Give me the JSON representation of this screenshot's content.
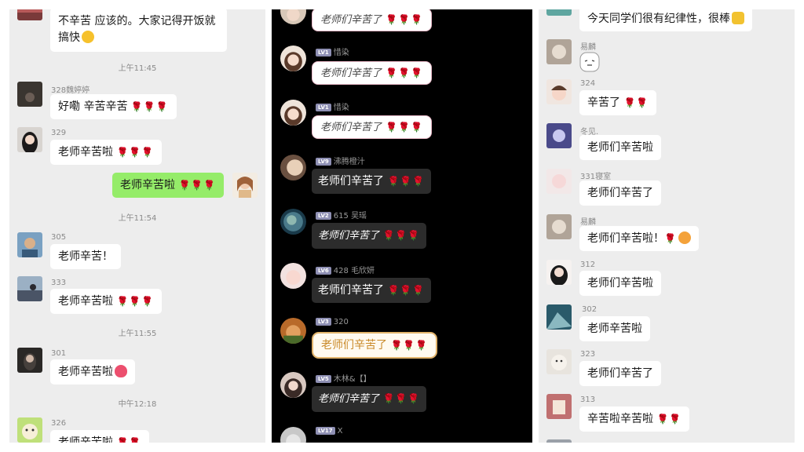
{
  "left": {
    "top_message": "不辛苦 应该的。大家记得开饭就搞快",
    "time1": "上午11:45",
    "m1_name": "328魏婷婷",
    "m1_text": "好嘞 辛苦辛苦",
    "m2_name": "329",
    "m2_text": "老师辛苦啦",
    "self_text": "老师辛苦啦",
    "time2": "上午11:54",
    "m3_name": "305",
    "m3_text": "老师辛苦！",
    "m4_name": "333",
    "m4_text": "老师辛苦啦",
    "time3": "上午11:55",
    "m5_name": "301",
    "m5_text": "老师辛苦啦",
    "time4": "中午12:18",
    "m6_name": "326",
    "m6_text": "老师辛苦啦"
  },
  "middle": {
    "msg1_text": "老师们辛苦了",
    "msg2_badge": "LV1",
    "msg2_name": "惜染",
    "msg2_text": "老师们辛苦了",
    "msg3_badge": "LV1",
    "msg3_name": "惜染",
    "msg3_text": "老师们辛苦了",
    "msg4_badge": "LV9",
    "msg4_name": "沸腾橙汁",
    "msg4_text": "老师们辛苦了",
    "msg5_badge": "LV2",
    "msg5_name": "615 吴瑶",
    "msg5_text": "老师们辛苦了",
    "msg6_badge": "LV6",
    "msg6_name": "428 毛欣妍",
    "msg6_text": "老师们辛苦了",
    "msg7_badge": "LV3",
    "msg7_name": "320",
    "msg7_text": "老师们辛苦了",
    "msg8_badge": "LV5",
    "msg8_name": "木林&【】",
    "msg8_text": "老师们辛苦了",
    "msg9_badge": "LV17",
    "msg9_name": "X"
  },
  "right": {
    "top_text": "今天同学们很有纪律性，很棒",
    "r1_name": "易麟",
    "r2_name": "324",
    "r2_text": "辛苦了",
    "r3_name": "冬见.",
    "r3_text": "老师们辛苦啦",
    "r4_name": "331寝室",
    "r4_text": "老师们辛苦了",
    "r5_name": "易麟",
    "r5_text": "老师们辛苦啦！",
    "r6_name": "312",
    "r6_text": "老师们辛苦啦",
    "r7_name": "302",
    "r7_text": "老师辛苦啦",
    "r8_name": "323",
    "r8_text": "老师们辛苦了",
    "r9_name": "313",
    "r9_text": "辛苦啦辛苦啦"
  },
  "icons": {
    "rose": "rose-icon",
    "grin": "grin-emoji",
    "heart": "heart-emoji",
    "thumb": "thumbs-up-emoji"
  },
  "colors": {
    "wechat_bg": "#ededed",
    "self_bubble": "#95ec69",
    "dark_bg": "#000000",
    "dark_bubble": "#2c2c2c",
    "rose": "#d51f2b"
  }
}
